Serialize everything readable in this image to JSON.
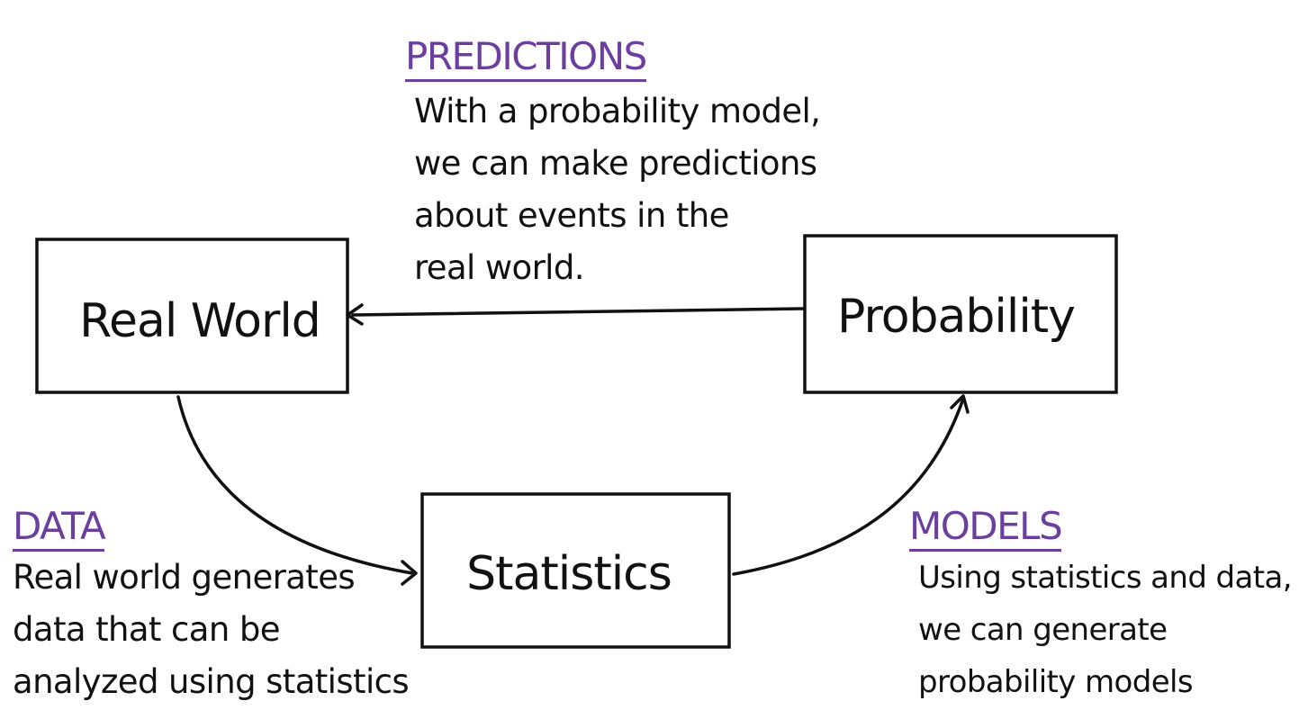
{
  "colors": {
    "ink": "#111111",
    "accent": "#6b3fa0",
    "background": "#ffffff"
  },
  "nodes": {
    "real_world": "Real World",
    "probability": "Probability",
    "statistics": "Statistics"
  },
  "notes": {
    "predictions": {
      "heading": "PREDICTIONS",
      "lines": [
        "With a probability model,",
        "we can make predictions",
        "about events in the",
        "real world."
      ]
    },
    "data": {
      "heading": "DATA",
      "lines": [
        "Real world generates",
        "data that can be",
        "analyzed using statistics"
      ]
    },
    "models": {
      "heading": "MODELS",
      "lines": [
        "Using statistics and data,",
        "we can generate",
        "probability models"
      ]
    }
  }
}
